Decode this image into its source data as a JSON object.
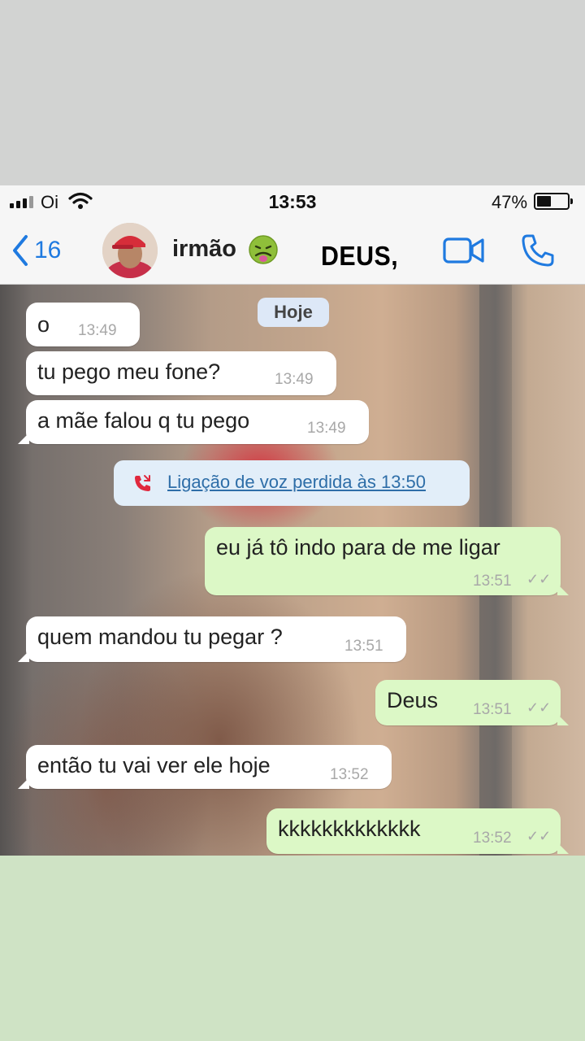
{
  "status_bar": {
    "carrier": "Oi",
    "time": "13:53",
    "battery": "47%",
    "battery_level": 0.47
  },
  "header": {
    "back_count": "16",
    "contact_name": "irmão",
    "contact_emoji": "nauseated-face",
    "overlay_caption": "DEUS,"
  },
  "chat": {
    "date_label": "Hoje",
    "missed_call": "Ligação de voz perdida às 13:50",
    "messages": [
      {
        "dir": "in",
        "text": "o",
        "time": "13:49"
      },
      {
        "dir": "in",
        "text": "tu pego meu fone?",
        "time": "13:49"
      },
      {
        "dir": "in",
        "text": "a mãe falou q tu pego",
        "time": "13:49"
      },
      {
        "dir": "out",
        "text": "eu já tô indo para de me ligar",
        "time": "13:51"
      },
      {
        "dir": "in",
        "text": "quem mandou tu pegar ?",
        "time": "13:51"
      },
      {
        "dir": "out",
        "text": "Deus",
        "time": "13:51"
      },
      {
        "dir": "in",
        "text": "então tu vai ver ele hoje",
        "time": "13:52"
      },
      {
        "dir": "out",
        "text": "kkkkkkkkkkkkk",
        "time": "13:52"
      }
    ]
  },
  "colors": {
    "incoming_bubble": "#ffffff",
    "outgoing_bubble": "#dcf8c6",
    "ios_blue": "#1f7ae0",
    "date_chip": "#dde8f7",
    "missed_call_bg": "#e2eef9"
  }
}
